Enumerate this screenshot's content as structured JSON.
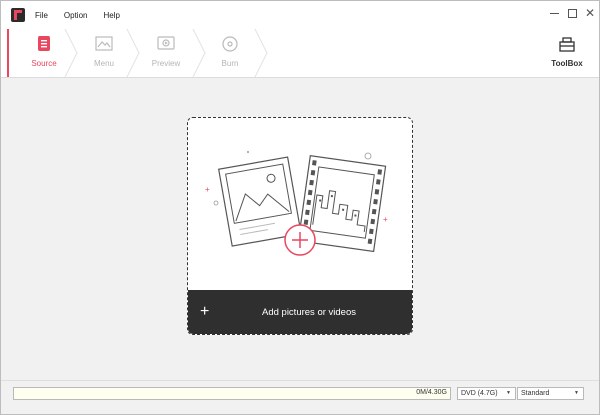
{
  "menu": {
    "items": [
      {
        "label": "File"
      },
      {
        "label": "Option"
      },
      {
        "label": "Help"
      }
    ]
  },
  "window_controls": {
    "minimize": "minimize-icon",
    "maximize": "maximize-icon",
    "close": "close-icon",
    "close_glyph": "✕"
  },
  "steps": [
    {
      "label": "Source",
      "icon": "source-icon",
      "active": true
    },
    {
      "label": "Menu",
      "icon": "menu-template-icon",
      "active": false
    },
    {
      "label": "Preview",
      "icon": "preview-icon",
      "active": false
    },
    {
      "label": "Burn",
      "icon": "burn-disc-icon",
      "active": false
    }
  ],
  "toolbox": {
    "label": "ToolBox",
    "icon": "toolbox-icon"
  },
  "dropzone": {
    "add_label": "Add pictures or videos",
    "add_glyph": "+",
    "illustration": "photo-and-film-add-icon"
  },
  "status": {
    "capacity_text": "0M/4.30G",
    "capacity_fraction": 0,
    "disc_type": "DVD (4.7G)",
    "quality": "Standard",
    "dropdown_arrow": "▼"
  },
  "colors": {
    "accent": "#e8475f",
    "add_bar": "#2f2f2f",
    "inactive": "#b5b5b5"
  }
}
